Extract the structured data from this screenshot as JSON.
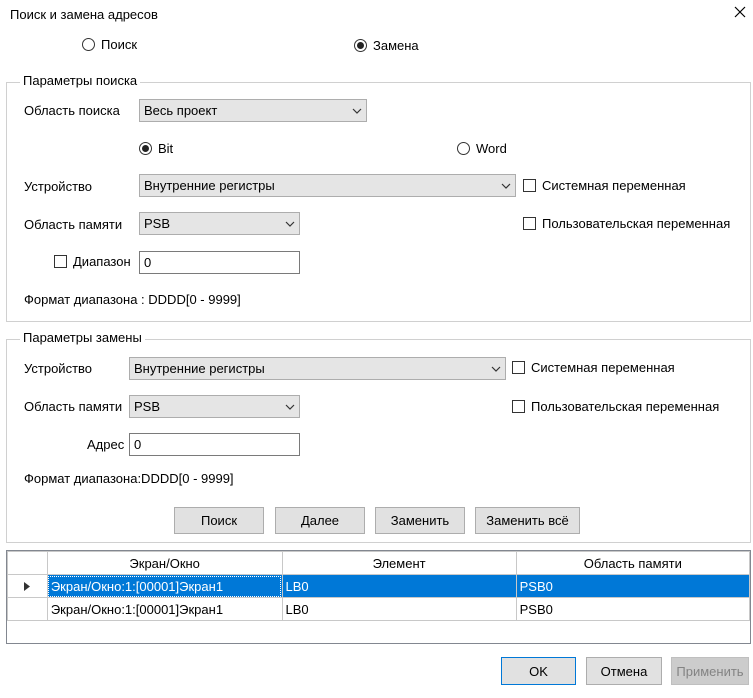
{
  "window": {
    "title": "Поиск и замена адресов"
  },
  "mode": {
    "search_label": "Поиск",
    "replace_label": "Замена",
    "selected": "replace"
  },
  "search_params": {
    "group_title": "Параметры поиска",
    "scope_label": "Область поиска",
    "scope_value": "Весь проект",
    "bit_label": "Bit",
    "word_label": "Word",
    "type_selected": "bit",
    "device_label": "Устройство",
    "device_value": "Внутренние регистры",
    "system_var_label": "Системная переменная",
    "memory_label": "Область памяти",
    "memory_value": "PSB",
    "user_var_label": "Пользовательская переменная",
    "range_label": "Диапазон",
    "range_value": "0",
    "format_text": "Формат диапазона : DDDD[0 - 9999]"
  },
  "replace_params": {
    "group_title": "Параметры замены",
    "device_label": "Устройство",
    "device_value": "Внутренние регистры",
    "system_var_label": "Системная переменная",
    "memory_label": "Область памяти",
    "memory_value": "PSB",
    "user_var_label": "Пользовательская переменная",
    "address_label": "Адрес",
    "address_value": "0",
    "format_text": "Формат диапазона:DDDD[0 - 9999]"
  },
  "actions": {
    "search": "Поиск",
    "next": "Далее",
    "replace": "Заменить",
    "replace_all": "Заменить всё"
  },
  "results": {
    "columns": [
      "Экран/Окно",
      "Элемент",
      "Область памяти"
    ],
    "rows": [
      [
        "Экран/Окно:1:[00001]Экран1",
        "LB0",
        "PSB0"
      ],
      [
        "Экран/Окно:1:[00001]Экран1",
        "LB0",
        "PSB0"
      ]
    ]
  },
  "footer": {
    "ok": "OK",
    "cancel": "Отмена",
    "apply": "Применить"
  }
}
